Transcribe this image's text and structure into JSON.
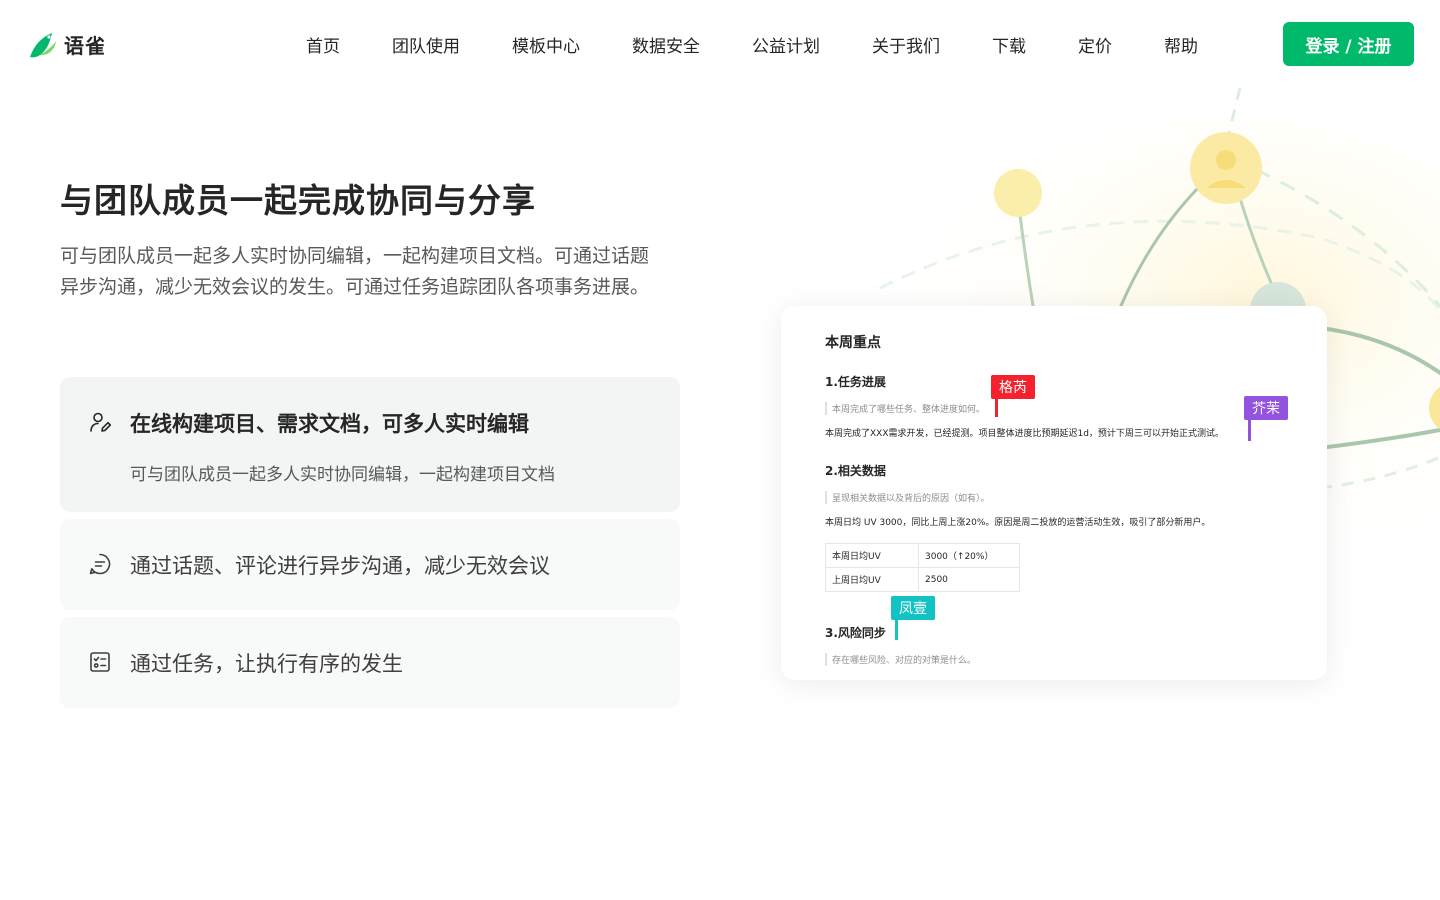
{
  "header": {
    "logo_text": "语雀",
    "nav": [
      "首页",
      "团队使用",
      "模板中心",
      "数据安全",
      "公益计划",
      "关于我们",
      "下载",
      "定价",
      "帮助"
    ],
    "login_label": "登录 / 注册",
    "colors": {
      "brand": "#00b96b"
    }
  },
  "hero": {
    "title": "与团队成员一起完成协同与分享",
    "description": "可与团队成员一起多人实时协同编辑，一起构建项目文档。可通过话题异步沟通，减少无效会议的发生。可通过任务追踪团队各项事务进展。"
  },
  "features": [
    {
      "icon": "user-edit-icon",
      "title": "在线构建项目、需求文档，可多人实时编辑",
      "subtitle": "可与团队成员一起多人实时协同编辑，一起构建项目文档",
      "active": true
    },
    {
      "icon": "chat-bubble-icon",
      "title": "通过话题、评论进行异步沟通，减少无效会议",
      "active": false
    },
    {
      "icon": "task-list-icon",
      "title": "通过任务，让执行有序的发生",
      "active": false
    }
  ],
  "doc": {
    "heading": "本周重点",
    "sections": [
      {
        "title": "1.任务进展",
        "quote": "本周完成了哪些任务、整体进度如何。",
        "text": "本周完成了XXX需求开发，已经提测。项目整体进度比预期延迟1d，预计下周三可以开始正式测试。"
      },
      {
        "title": "2.相关数据",
        "quote": "呈现相关数据以及背后的原因（如有）。",
        "text": "本周日均 UV 3000，同比上周上涨20%。原因是周二投放的运营活动生效，吸引了部分新用户。"
      },
      {
        "title": "3.风险同步",
        "quote": "存在哪些风险、对应的对策是什么。"
      }
    ],
    "table": [
      [
        "本周日均UV",
        "3000（↑20%）"
      ],
      [
        "上周日均UV",
        "2500"
      ]
    ],
    "cursors": [
      {
        "name": "格芮",
        "color": "#f5222d"
      },
      {
        "name": "芥茉",
        "color": "#9254de"
      },
      {
        "name": "凤壹",
        "color": "#13c2c2"
      }
    ]
  }
}
